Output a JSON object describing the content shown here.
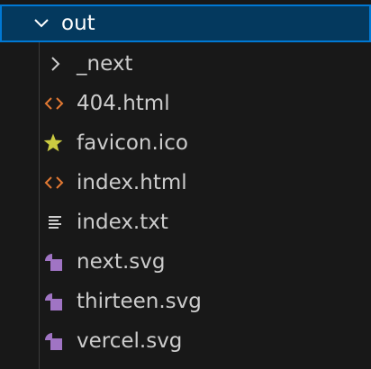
{
  "folder": {
    "name": "out",
    "expanded": true
  },
  "items": [
    {
      "label": "_next",
      "kind": "folder",
      "icon": "chevron-right-icon"
    },
    {
      "label": "404.html",
      "kind": "file",
      "icon": "html-code-icon",
      "icon_color": "#e37933"
    },
    {
      "label": "favicon.ico",
      "kind": "file",
      "icon": "star-icon",
      "icon_color": "#cbcb41"
    },
    {
      "label": "index.html",
      "kind": "file",
      "icon": "html-code-icon",
      "icon_color": "#e37933"
    },
    {
      "label": "index.txt",
      "kind": "file",
      "icon": "text-lines-icon",
      "icon_color": "#cccccc"
    },
    {
      "label": "next.svg",
      "kind": "file",
      "icon": "svg-shapes-icon",
      "icon_color": "#a074c4"
    },
    {
      "label": "thirteen.svg",
      "kind": "file",
      "icon": "svg-shapes-icon",
      "icon_color": "#a074c4"
    },
    {
      "label": "vercel.svg",
      "kind": "file",
      "icon": "svg-shapes-icon",
      "icon_color": "#a074c4"
    }
  ],
  "colors": {
    "background": "#181818",
    "selection_bg": "#04395e",
    "selection_border": "#0078d4",
    "text": "#cccccc"
  }
}
